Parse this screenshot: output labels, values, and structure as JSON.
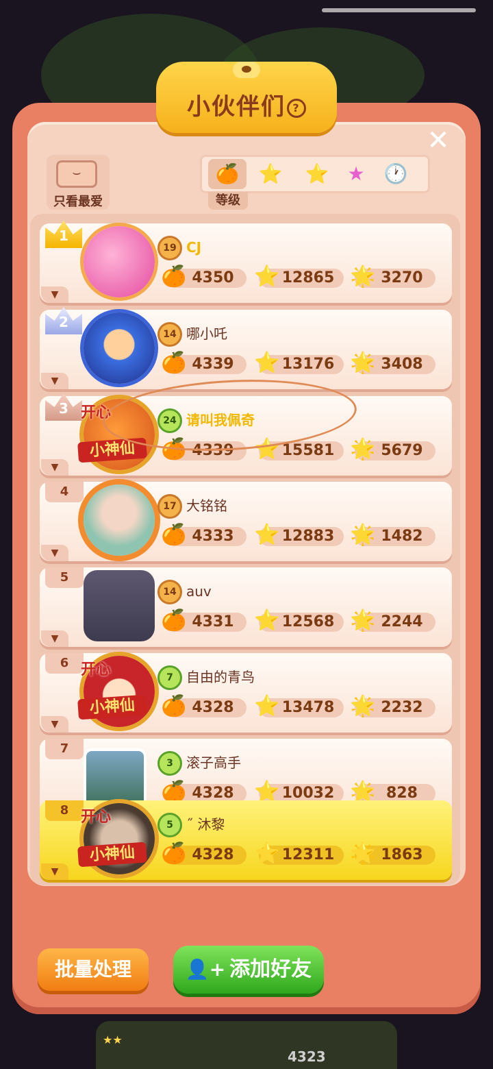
{
  "title": "小伙伴们",
  "help_icon": "?",
  "close_icon": "✕",
  "favorites_only_label": "只看最爱",
  "sort_tabs": [
    {
      "icon": "🍊",
      "name": "level"
    },
    {
      "icon": "⭐",
      "name": "gold-star"
    },
    {
      "icon": "⭐",
      "name": "rainbow-star"
    },
    {
      "icon": "★",
      "name": "pink-star"
    },
    {
      "icon": "🕐",
      "name": "clock"
    }
  ],
  "active_sort_label": "等级",
  "friends": [
    {
      "rank": "1",
      "level": "19",
      "name": "CJ",
      "fruit": "4350",
      "gold_star": "12865",
      "rainbow_star": "3270"
    },
    {
      "rank": "2",
      "level": "14",
      "name": "哪小吒",
      "fruit": "4339",
      "gold_star": "13176",
      "rainbow_star": "3408"
    },
    {
      "rank": "3",
      "level": "24",
      "name": "请叫我佩奇",
      "fruit": "4339",
      "gold_star": "15581",
      "rainbow_star": "5679",
      "badge_top": "开心",
      "badge": "小神仙"
    },
    {
      "rank": "4",
      "level": "17",
      "name": "大铭铭",
      "fruit": "4333",
      "gold_star": "12883",
      "rainbow_star": "1482"
    },
    {
      "rank": "5",
      "level": "14",
      "name": "auv",
      "fruit": "4331",
      "gold_star": "12568",
      "rainbow_star": "2244"
    },
    {
      "rank": "6",
      "level": "7",
      "name": "自由的青鸟",
      "fruit": "4328",
      "gold_star": "13478",
      "rainbow_star": "2232",
      "badge_top": "开心",
      "badge": "小神仙"
    },
    {
      "rank": "7",
      "level": "3",
      "name": "滚子高手",
      "fruit": "4328",
      "gold_star": "10032",
      "rainbow_star": "828"
    },
    {
      "rank": "8",
      "level": "5",
      "name": "˝ 沐黎",
      "fruit": "4328",
      "gold_star": "12311",
      "rainbow_star": "1863",
      "badge_top": "开心",
      "badge": "小神仙"
    }
  ],
  "buttons": {
    "batch": "批量处理",
    "add_friend": "添加好友"
  },
  "background_score": "4323",
  "colors": {
    "panel": "#e97f63",
    "highlight_row": "#f7d61e",
    "batch_button": "#f07d12",
    "add_button": "#2fa81d",
    "annotation": "#e08a55"
  }
}
